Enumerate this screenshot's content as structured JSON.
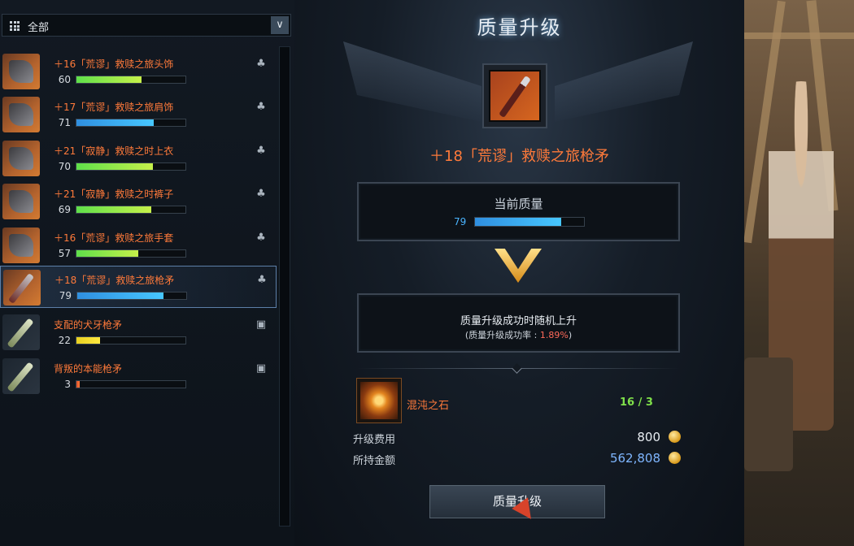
{
  "filter": {
    "selected": "全部"
  },
  "items": [
    {
      "name": "＋16「荒谬」救赎之旅头饰",
      "quality": "60",
      "fill": 0.6,
      "color": "green",
      "kind": "helmet"
    },
    {
      "name": "＋17「荒谬」救赎之旅肩饰",
      "quality": "71",
      "fill": 0.71,
      "color": "blue",
      "kind": "shoulder"
    },
    {
      "name": "＋21「寂静」救赎之时上衣",
      "quality": "70",
      "fill": 0.7,
      "color": "green",
      "kind": "top"
    },
    {
      "name": "＋21「寂静」救赎之时裤子",
      "quality": "69",
      "fill": 0.69,
      "color": "green",
      "kind": "pants"
    },
    {
      "name": "＋16「荒谬」救赎之旅手套",
      "quality": "57",
      "fill": 0.57,
      "color": "green",
      "kind": "gloves"
    },
    {
      "name": "＋18「荒谬」救赎之旅枪矛",
      "quality": "79",
      "fill": 0.79,
      "color": "blue",
      "kind": "spear"
    },
    {
      "name": "支配的犬牙枪矛",
      "quality": "22",
      "fill": 0.22,
      "color": "yellow",
      "kind": "spear-plain"
    },
    {
      "name": "背叛的本能枪矛",
      "quality": "3",
      "fill": 0.03,
      "color": "orange",
      "kind": "spear-plain"
    }
  ],
  "panel": {
    "title": "质量升级",
    "target_name": "＋18「荒谬」救赎之旅枪矛",
    "current_quality_label": "当前质量",
    "current_quality": "79",
    "current_quality_fill": 0.79,
    "info_line1": "质量升级成功时随机上升",
    "info_line2_prefix": "(质量升级成功率 : ",
    "info_rate": "1.89%",
    "info_line2_suffix": ")",
    "material_name": "混沌之石",
    "material_count": "16 / 3",
    "cost_label": "升级费用",
    "cost_value": "800",
    "owned_label": "所持金额",
    "owned_value": "562,808",
    "button_label": "质量升级"
  },
  "colors": {
    "accent_orange": "#ff7a3a",
    "quality_blue": "#4ab4ff",
    "count_green": "#7fe04a"
  }
}
